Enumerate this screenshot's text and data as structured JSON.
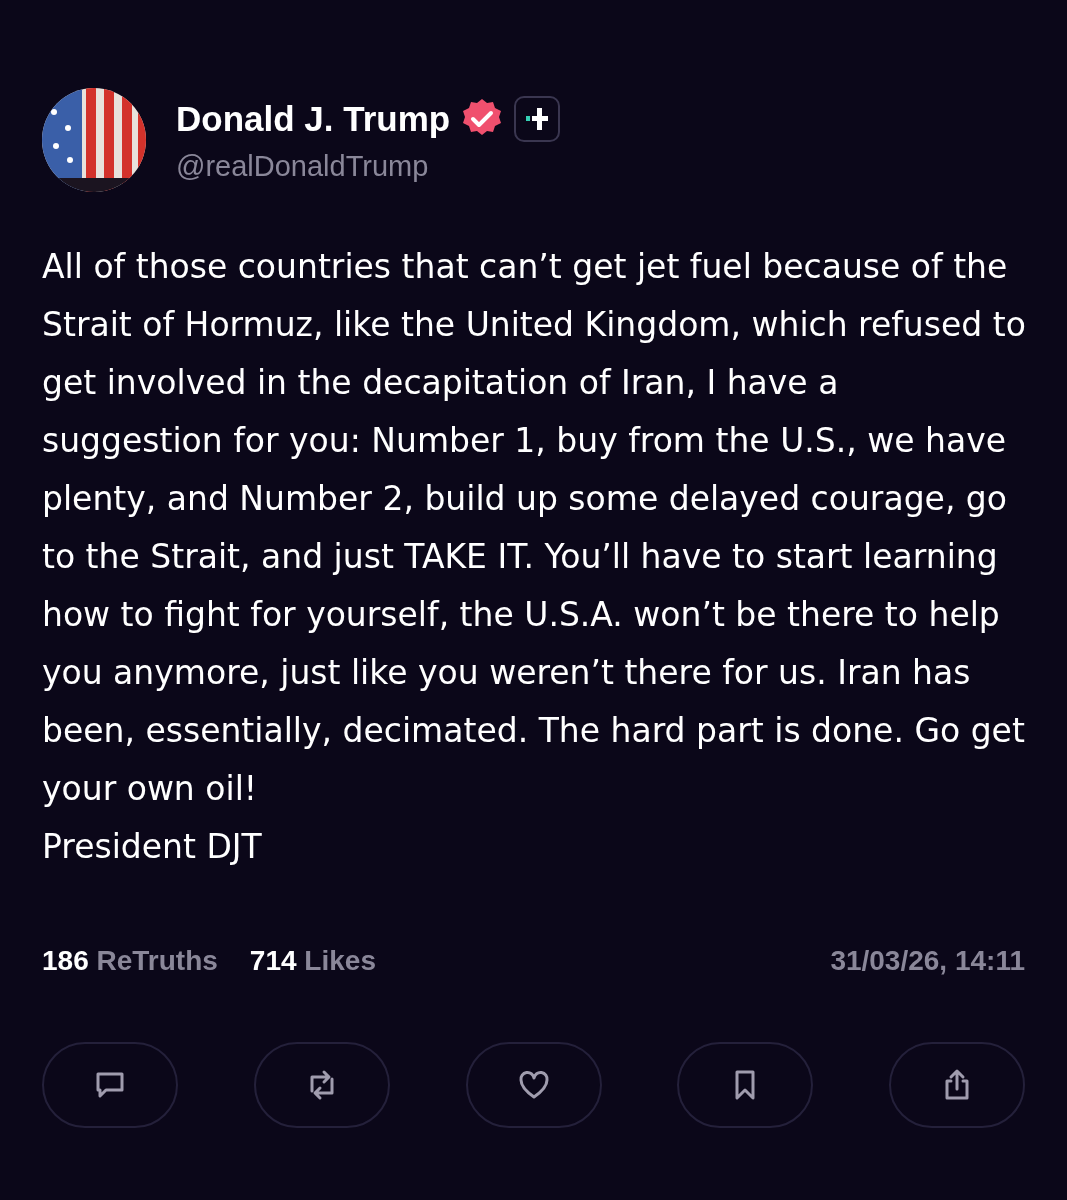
{
  "post": {
    "author": {
      "name": "Donald J. Trump",
      "handle": "@realDonaldTrump",
      "verified": true
    },
    "paragraphs": [
      "All of those countries that can’t get jet fuel because of the Strait of Hormuz, like the United Kingdom, which refused to get involved in the decapitation of Iran, I have a suggestion for you: Number 1, buy from the U.S., we have plenty, and Number 2, build up some delayed courage, go to the Strait, and just TAKE IT. You’ll have to start learning how to fight for yourself, the U.S.A. won’t be there to help you anymore, just like you weren’t there for us. Iran has been, essentially, decimated. The hard part is done. Go get your own oil!",
      "President DJT"
    ],
    "stats": [
      {
        "count": "186",
        "label": "ReTruths"
      },
      {
        "count": "714",
        "label": "Likes"
      }
    ],
    "timestamp": "31/03/26, 14:11",
    "actions": [
      {
        "kind": "reply"
      },
      {
        "kind": "retruth"
      },
      {
        "kind": "like"
      },
      {
        "kind": "bookmark"
      },
      {
        "kind": "share"
      }
    ]
  }
}
